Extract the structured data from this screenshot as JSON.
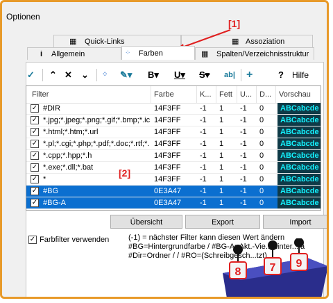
{
  "window": {
    "title": "Optionen"
  },
  "tabs_top": [
    {
      "label": "Quick-Links",
      "icon": "quick-links-icon"
    },
    {
      "label": "Assoziation",
      "icon": "association-icon"
    }
  ],
  "tabs_bottom": [
    {
      "label": "Allgemein",
      "icon": "info-icon"
    },
    {
      "label": "Farben",
      "icon": "colors-icon"
    },
    {
      "label": "Spalten/Verzeichnisstruktur",
      "icon": "columns-icon"
    }
  ],
  "annotations": {
    "one": "[1]",
    "two": "[2]"
  },
  "toolbar": {
    "help_label": "Hilfe",
    "help_glyph": "?",
    "text_color_glyph": "ab|"
  },
  "table": {
    "headers": [
      "Filter",
      "Farbe",
      "K...",
      "Fett",
      "U...",
      "D...",
      "Vorschau"
    ],
    "rows": [
      {
        "filter": "#DIR",
        "farbe": "14F3FF",
        "k": "-1",
        "fett": "1",
        "u": "-1",
        "d": "0",
        "preview": "ABCabcde",
        "selected": false
      },
      {
        "filter": "*.jpg;*.jpeg;*.png;*.gif;*.bmp;*.ico",
        "farbe": "14F3FF",
        "k": "-1",
        "fett": "1",
        "u": "-1",
        "d": "0",
        "preview": "ABCabcde",
        "selected": false
      },
      {
        "filter": "*.html;*.htm;*.url",
        "farbe": "14F3FF",
        "k": "-1",
        "fett": "1",
        "u": "-1",
        "d": "0",
        "preview": "ABCabcde",
        "selected": false
      },
      {
        "filter": "*.pl;*.cgi;*.php;*.pdf;*.doc;*.rtf;*...",
        "farbe": "14F3FF",
        "k": "-1",
        "fett": "1",
        "u": "-1",
        "d": "0",
        "preview": "ABCabcde",
        "selected": false
      },
      {
        "filter": "*.cpp;*.hpp;*.h",
        "farbe": "14F3FF",
        "k": "-1",
        "fett": "1",
        "u": "-1",
        "d": "0",
        "preview": "ABCabcde",
        "selected": false
      },
      {
        "filter": "*.exe;*.dll;*.bat",
        "farbe": "14F3FF",
        "k": "-1",
        "fett": "1",
        "u": "-1",
        "d": "0",
        "preview": "ABCabcde",
        "selected": false
      },
      {
        "filter": "*",
        "farbe": "14F3FF",
        "k": "-1",
        "fett": "1",
        "u": "-1",
        "d": "0",
        "preview": "ABCabcde",
        "selected": false
      },
      {
        "filter": "#BG",
        "farbe": "0E3A47",
        "k": "-1",
        "fett": "1",
        "u": "-1",
        "d": "0",
        "preview": "ABCabcde",
        "selected": true
      },
      {
        "filter": "#BG-A",
        "farbe": "0E3A47",
        "k": "-1",
        "fett": "1",
        "u": "-1",
        "d": "0",
        "preview": "ABCabcde",
        "selected": true
      }
    ]
  },
  "buttons": {
    "overview": "Übersicht",
    "export": "Export",
    "import": "Import"
  },
  "options": {
    "use_filter_label": "Farbfilter verwenden",
    "use_filter_checked": true
  },
  "legend": [
    "(-1) = nächster Filter kann diesen Wert ändern",
    "#BG=Hintergrundfarbe / #BG-A=Akt.-Vie...Hinter...fa",
    "#Dir=Ordner / / #RO=(Schreibgesch...tzt)"
  ],
  "mascots": [
    "8",
    "7",
    "9"
  ],
  "colors": {
    "accent": "#0b6fd0",
    "preview_bg": "#0e3a47",
    "preview_fg": "#14f3ff",
    "frame": "#e89a2a",
    "annotation": "#e02020"
  }
}
